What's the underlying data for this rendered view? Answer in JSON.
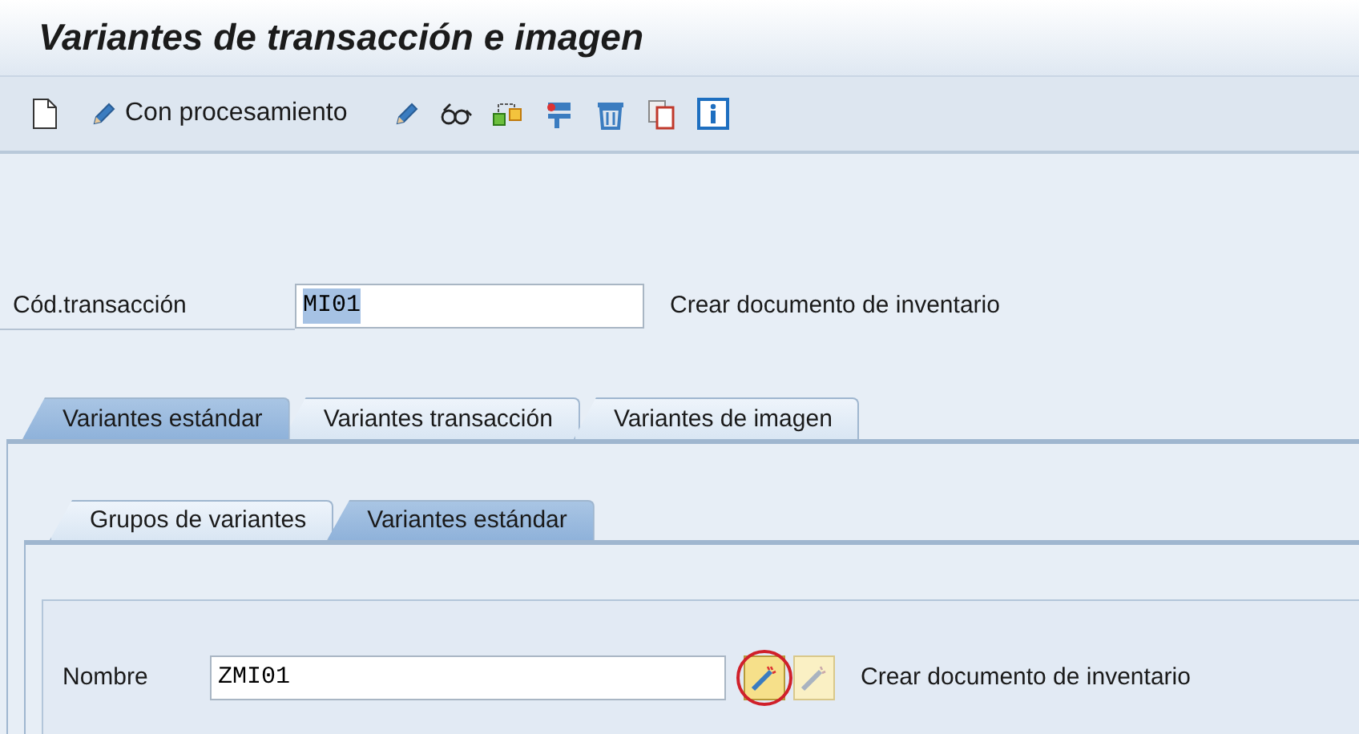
{
  "window": {
    "title": "Variantes de transacción e imagen"
  },
  "toolbar": {
    "process_button": "Con procesamiento"
  },
  "transaction": {
    "label": "Cód.transacción",
    "value": "MI01",
    "value_selected": true,
    "description": "Crear documento de inventario"
  },
  "tabs": [
    {
      "label": "Variantes estándar",
      "selected": true
    },
    {
      "label": "Variantes transacción",
      "selected": false
    },
    {
      "label": "Variantes de imagen",
      "selected": false
    }
  ],
  "subtabs": [
    {
      "label": "Grupos de variantes",
      "selected": false
    },
    {
      "label": "Variantes estándar",
      "selected": true
    }
  ],
  "variant": {
    "label": "Nombre",
    "value": "ZMI01",
    "description": "Crear documento de inventario",
    "create_highlighted": true
  }
}
